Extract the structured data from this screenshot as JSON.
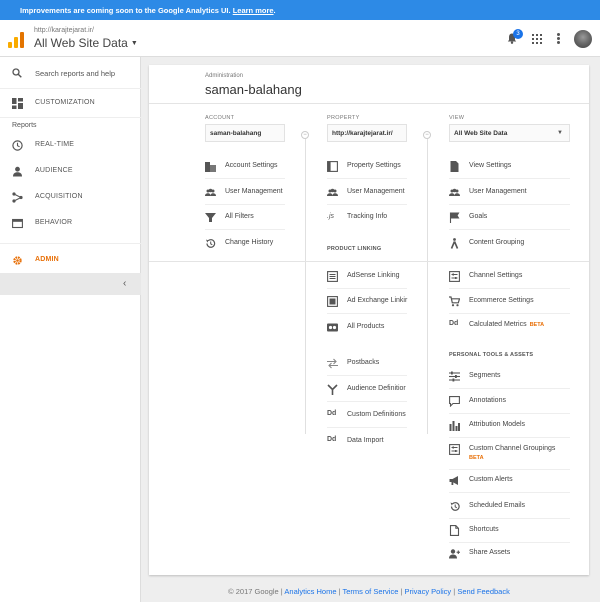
{
  "banner": {
    "text": "Improvements are coming soon to the Google Analytics UI.",
    "link": "Learn more",
    "end": "."
  },
  "header": {
    "site_url": "http://karajtejarat.ir/",
    "view_name": "All Web Site Data",
    "notification_count": "3"
  },
  "sidebar": {
    "search_placeholder": "Search reports and help",
    "customization": "CUSTOMIZATION",
    "reports_label": "Reports",
    "items": [
      "REAL-TIME",
      "AUDIENCE",
      "ACQUISITION",
      "BEHAVIOR"
    ],
    "admin": "ADMIN"
  },
  "admin": {
    "label": "Administration",
    "title": "saman-balahang",
    "account": {
      "header": "ACCOUNT",
      "selected": "saman-balahang",
      "items": [
        "Account Settings",
        "User Management",
        "All Filters",
        "Change History"
      ]
    },
    "property": {
      "header": "PROPERTY",
      "selected": "http://karajtejarat.ir/",
      "items": [
        "Property Settings",
        "User Management",
        "Tracking Info"
      ],
      "product_linking_header": "PRODUCT LINKING",
      "product_linking": [
        "AdSense Linking",
        "Ad Exchange Linkir",
        "All Products",
        "Postbacks",
        "Audience Definitior",
        "Custom Definitions",
        "Data Import"
      ]
    },
    "view": {
      "header": "VIEW",
      "selected": "All Web Site Data",
      "items": [
        "View Settings",
        "User Management",
        "Goals",
        "Content Grouping",
        "Channel Settings",
        "Ecommerce Settings",
        "Calculated Metrics"
      ],
      "beta": "BETA",
      "personal_header": "PERSONAL TOOLS & ASSETS",
      "personal": [
        "Segments",
        "Annotations",
        "Attribution Models",
        "Custom Channel Groupings",
        "Custom Alerts",
        "Scheduled Emails",
        "Shortcuts",
        "Share Assets"
      ]
    }
  },
  "footer": {
    "copyright": "© 2017 Google",
    "links": [
      "Analytics Home",
      "Terms of Service",
      "Privacy Policy",
      "Send Feedback"
    ]
  },
  "colors": {
    "banner": "#2d8ae6",
    "accent": "#e8710a",
    "link": "#1a73e8"
  }
}
